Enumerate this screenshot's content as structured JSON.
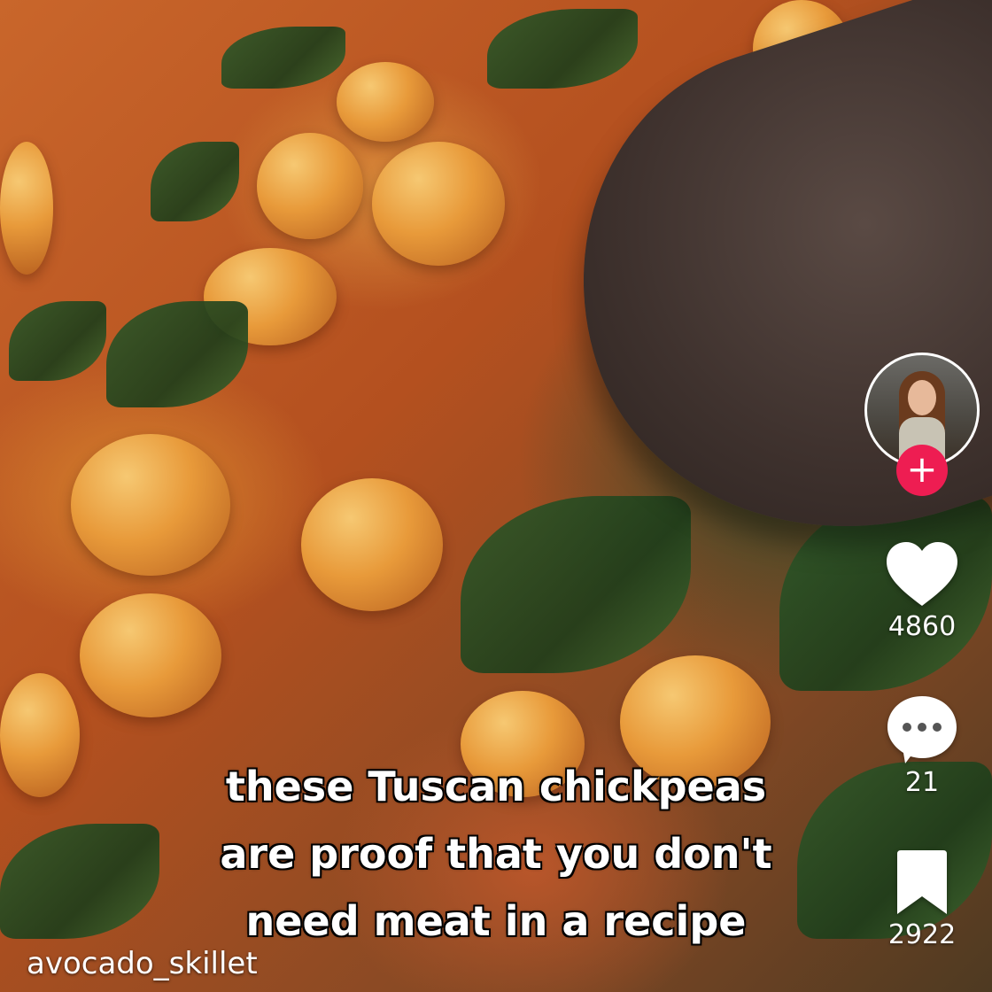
{
  "video": {
    "caption_lines": [
      "these Tuscan chickpeas",
      "are proof that you don't",
      "need meat in a recipe"
    ],
    "username": "avocado_skillet"
  },
  "actions": {
    "follow_icon": "plus-icon",
    "follow_color": "#ee1d52",
    "likes": "4860",
    "comments": "21",
    "saves": "2922"
  }
}
